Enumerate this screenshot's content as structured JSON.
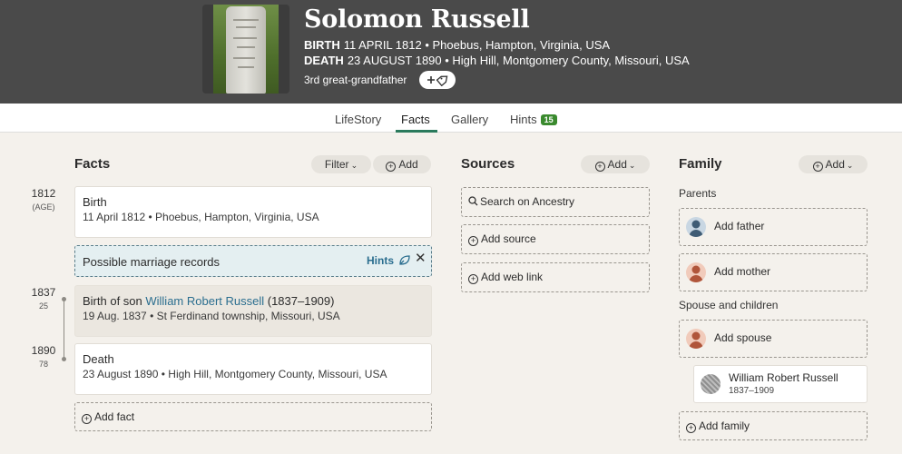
{
  "person": {
    "name": "Solomon Russell",
    "birth_label": "BIRTH",
    "birth_value": "11 APRIL 1812 • Phoebus, Hampton, Virginia, USA",
    "death_label": "DEATH",
    "death_value": "23 AUGUST 1890 • High Hill, Montgomery County, Missouri, USA",
    "relationship": "3rd great-grandfather"
  },
  "tabs": [
    {
      "label": "LifeStory"
    },
    {
      "label": "Facts"
    },
    {
      "label": "Gallery"
    },
    {
      "label": "Hints",
      "badge": "15"
    }
  ],
  "facts": {
    "title": "Facts",
    "filter_label": "Filter",
    "add_label": "Add",
    "items": [
      {
        "year": "1812",
        "age": "(AGE)",
        "title": "Birth",
        "detail": "11 April 1812 • Phoebus, Hampton, Virginia, USA"
      },
      {
        "year": "1837",
        "age": "25",
        "title_prefix": "Birth of son ",
        "title_link": "William Robert Russell",
        "title_suffix": " (1837–1909)",
        "detail": "19 Aug. 1837 • St Ferdinand township, Missouri, USA"
      },
      {
        "year": "1890",
        "age": "78",
        "title": "Death",
        "detail": "23 August 1890 • High Hill, Montgomery County, Missouri, USA"
      }
    ],
    "hint_banner": {
      "text": "Possible marriage records",
      "link": "Hints"
    },
    "add_fact_label": "Add fact"
  },
  "sources": {
    "title": "Sources",
    "add_label": "Add",
    "search_label": "Search on Ancestry",
    "add_source_label": "Add source",
    "add_web_link_label": "Add web link"
  },
  "family": {
    "title": "Family",
    "add_label": "Add",
    "parents_label": "Parents",
    "add_father": "Add father",
    "add_mother": "Add mother",
    "spouse_label": "Spouse and children",
    "add_spouse": "Add spouse",
    "child_name": "William Robert Russell",
    "child_years": "1837–1909",
    "add_family": "Add family"
  },
  "colors": {
    "header": "#4a4a4a",
    "accent": "#2a7a5c",
    "link": "#2b6e8f",
    "badge": "#3a8a2e",
    "hint_bg": "#e4eff1"
  }
}
